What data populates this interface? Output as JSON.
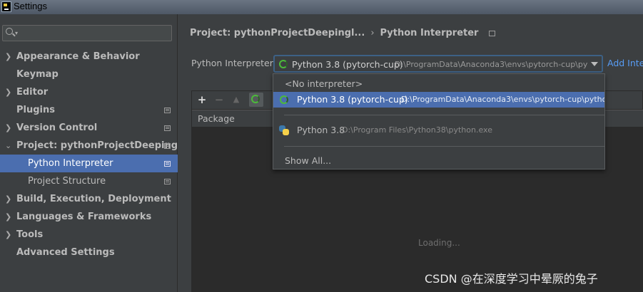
{
  "window": {
    "title": "Settings"
  },
  "sidebar": {
    "search_placeholder": "",
    "items": [
      {
        "label": "Appearance & Behavior",
        "expandable": true
      },
      {
        "label": "Keymap",
        "expandable": false
      },
      {
        "label": "Editor",
        "expandable": true
      },
      {
        "label": "Plugins",
        "expandable": false,
        "icon": "project-icon"
      },
      {
        "label": "Version Control",
        "expandable": true,
        "icon": "project-icon"
      },
      {
        "label": "Project: pythonProjectDeepingl...",
        "expandable": true,
        "expanded": true,
        "icon": "project-icon"
      },
      {
        "label": "Python Interpreter",
        "sub": true,
        "selected": true,
        "icon": "project-icon"
      },
      {
        "label": "Project Structure",
        "sub": true,
        "icon": "project-icon"
      },
      {
        "label": "Build, Execution, Deployment",
        "expandable": true
      },
      {
        "label": "Languages & Frameworks",
        "expandable": true
      },
      {
        "label": "Tools",
        "expandable": true
      },
      {
        "label": "Advanced Settings",
        "expandable": false
      }
    ]
  },
  "breadcrumb": {
    "project": "Project: pythonProjectDeepingl...",
    "separator": "›",
    "page": "Python Interpreter"
  },
  "interpreter": {
    "label": "Python Interpreter:",
    "selected_name": "Python 3.8 (pytorch-cup)",
    "selected_path": "D:\\ProgramData\\Anaconda3\\envs\\pytorch-cup\\py",
    "add_link": "Add Inte"
  },
  "dropdown": {
    "options": [
      {
        "name": "<No interpreter>"
      },
      {
        "name": "Python 3.8 (pytorch-cup)",
        "path": "D:\\ProgramData\\Anaconda3\\envs\\pytorch-cup\\pytho",
        "selected": true,
        "icon": "conda-spinner-icon"
      },
      {
        "name": "Python 3.8",
        "path": "D:\\Program Files\\Python38\\python.exe",
        "icon": "python-logo-icon"
      },
      {
        "name": "Show All..."
      }
    ]
  },
  "toolbar": {
    "add": "+",
    "remove": "−",
    "up": "▲"
  },
  "table": {
    "column": "Package",
    "status": "Loading..."
  },
  "watermark": "CSDN @在深度学习中晕厥的兔子",
  "colors": {
    "background": "#3c3f41",
    "selection": "#4b6eaf",
    "link": "#589df6",
    "focus_border": "#3d6185"
  }
}
